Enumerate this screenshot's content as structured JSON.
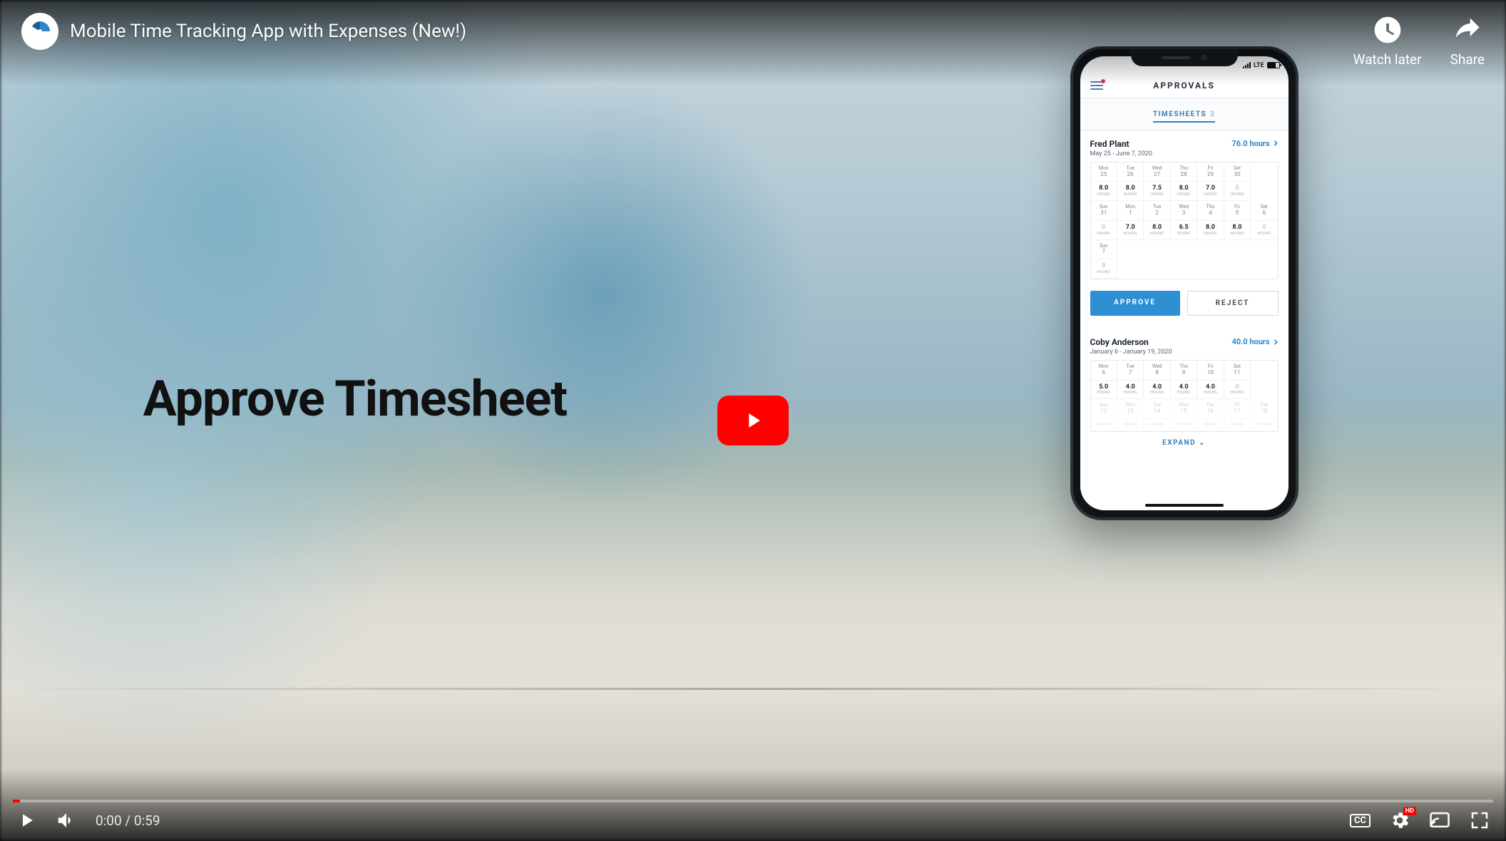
{
  "video": {
    "title": "Mobile Time Tracking App with Expenses (New!)",
    "watch_later": "Watch later",
    "share": "Share",
    "time_current": "0:00",
    "time_total": "0:59",
    "cc_label": "CC",
    "hd_label": "HD"
  },
  "content": {
    "heading": "Approve Timesheet"
  },
  "phone": {
    "status": {
      "network": "LTE"
    },
    "app": {
      "title": "APPROVALS",
      "tab_label": "TIMESHEETS",
      "tab_count": "3",
      "expand": "EXPAND ⌄",
      "actions": {
        "approve": "APPROVE",
        "reject": "REJECT"
      },
      "hours_unit": "HOURS",
      "sheets": [
        {
          "name": "Fred Plant",
          "range": "May 25 - June 7, 2020",
          "total": "76.0 hours",
          "weeks": [
            {
              "days": [
                {
                  "dow": "Mon",
                  "num": "25",
                  "val": "8.0"
                },
                {
                  "dow": "Tue",
                  "num": "26",
                  "val": "8.0"
                },
                {
                  "dow": "Wed",
                  "num": "27",
                  "val": "7.5"
                },
                {
                  "dow": "Thu",
                  "num": "28",
                  "val": "8.0"
                },
                {
                  "dow": "Fri",
                  "num": "29",
                  "val": "7.0"
                },
                {
                  "dow": "Sat",
                  "num": "30",
                  "val": "0",
                  "muted": true
                }
              ]
            },
            {
              "days": [
                {
                  "dow": "Sun",
                  "num": "31",
                  "val": "0",
                  "muted": true
                },
                {
                  "dow": "Mon",
                  "num": "1",
                  "val": "7.0"
                },
                {
                  "dow": "Tue",
                  "num": "2",
                  "val": "8.0"
                },
                {
                  "dow": "Wed",
                  "num": "3",
                  "val": "6.5"
                },
                {
                  "dow": "Thu",
                  "num": "4",
                  "val": "8.0"
                },
                {
                  "dow": "Fri",
                  "num": "5",
                  "val": "8.0"
                },
                {
                  "dow": "Sat",
                  "num": "6",
                  "val": "0",
                  "muted": true
                }
              ]
            },
            {
              "days": [
                {
                  "dow": "Sun",
                  "num": "7",
                  "val": "0",
                  "muted": true
                }
              ]
            }
          ]
        },
        {
          "name": "Coby Anderson",
          "range": "January 6 - January 19, 2020",
          "total": "40.0 hours",
          "weeks": [
            {
              "days": [
                {
                  "dow": "Mon",
                  "num": "6",
                  "val": "5.0"
                },
                {
                  "dow": "Tue",
                  "num": "7",
                  "val": "4.0"
                },
                {
                  "dow": "Wed",
                  "num": "8",
                  "val": "4.0"
                },
                {
                  "dow": "Thu",
                  "num": "9",
                  "val": "4.0"
                },
                {
                  "dow": "Fri",
                  "num": "10",
                  "val": "4.0"
                },
                {
                  "dow": "Sat",
                  "num": "11",
                  "val": "0",
                  "muted": true
                }
              ]
            },
            {
              "faded": true,
              "days": [
                {
                  "dow": "Sun",
                  "num": "12",
                  "val": ""
                },
                {
                  "dow": "Mon",
                  "num": "13",
                  "val": ""
                },
                {
                  "dow": "Tue",
                  "num": "14",
                  "val": ""
                },
                {
                  "dow": "Wed",
                  "num": "15",
                  "val": ""
                },
                {
                  "dow": "Thu",
                  "num": "16",
                  "val": ""
                },
                {
                  "dow": "Fri",
                  "num": "17",
                  "val": ""
                },
                {
                  "dow": "Sat",
                  "num": "18",
                  "val": ""
                }
              ]
            }
          ]
        }
      ]
    }
  }
}
